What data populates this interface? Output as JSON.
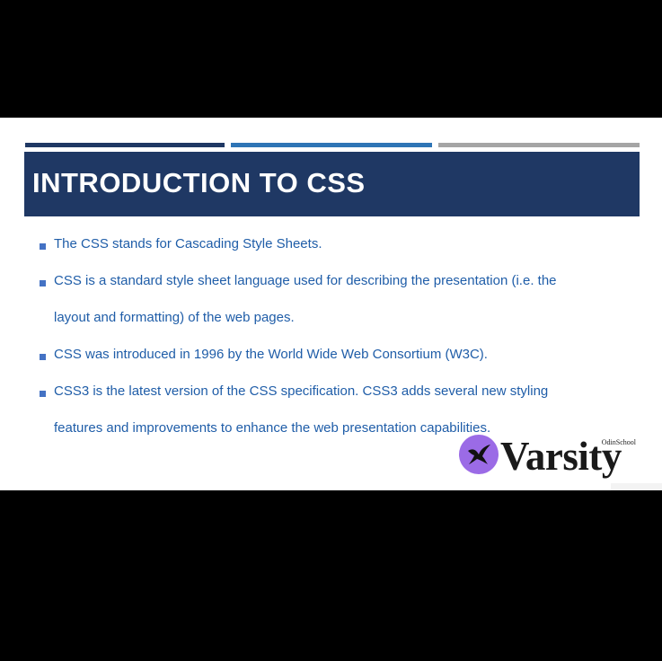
{
  "slide": {
    "title": "INTRODUCTION TO CSS",
    "bullets": [
      "The CSS stands for Cascading Style Sheets.",
      "CSS is a standard style sheet language used for describing the presentation (i.e. the layout and formatting) of the web pages.",
      "CSS was introduced in 1996 by the World Wide Web Consortium (W3C).",
      "CSS3 is the latest version of the CSS specification. CSS3 adds several new styling features and improvements to enhance the web presentation capabilities."
    ]
  },
  "logo": {
    "word": "Varsity",
    "brand": "OdinSchool"
  },
  "colors": {
    "title_band": "#1f3864",
    "accent_blue": "#2e75b6",
    "accent_gray": "#a5a5a5",
    "bullet_text": "#1f5da8",
    "logo_circle": "#9b6be6"
  }
}
